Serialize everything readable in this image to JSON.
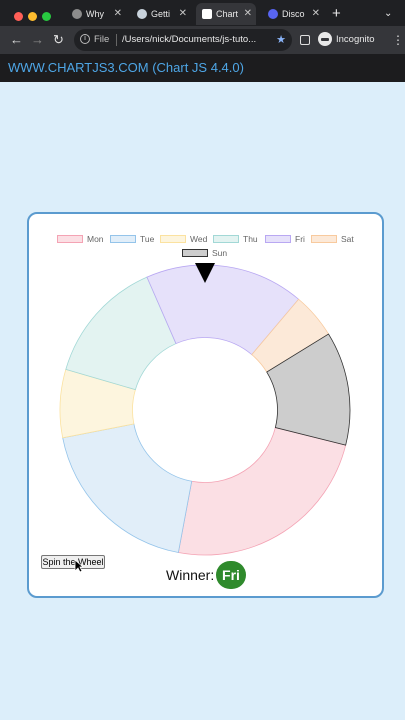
{
  "browser": {
    "tabs": [
      {
        "label": "Why",
        "icon": "github-icon",
        "active": false
      },
      {
        "label": "Getti",
        "icon": "wordpress-icon",
        "active": false
      },
      {
        "label": "Chart",
        "icon": "chart-logo-icon",
        "active": true
      },
      {
        "label": "Disco",
        "icon": "discord-icon",
        "active": false
      }
    ],
    "new_tab_label": "+",
    "file_label": "File",
    "url": "/Users/nick/Documents/js-tuto...",
    "profile_label": "Incognito",
    "window_controls_colors": [
      "#ff5f57",
      "#febc2e",
      "#28c840"
    ]
  },
  "site": {
    "title": "WWW.CHARTJS3.COM (Chart JS 4.4.0)"
  },
  "spin_button_label": "Spin the Wheel",
  "winner": {
    "label": "Winner:",
    "value": "Fri",
    "badge_color": "#2f8a2c"
  },
  "chart_data": {
    "type": "doughnut",
    "labels": [
      "Mon",
      "Tue",
      "Wed",
      "Thu",
      "Fri",
      "Sat",
      "Sun"
    ],
    "values": [
      19,
      15,
      6,
      11,
      14,
      4,
      10
    ],
    "background_colors": [
      "#fbdfe4",
      "#e1eef9",
      "#fdf5de",
      "#e3f3f1",
      "#e6e1fa",
      "#fce9d8",
      "#cdcdcd"
    ],
    "border_colors": [
      "#f4a3b4",
      "#94c4ea",
      "#fbe2a0",
      "#a2d8d6",
      "#b9a8f2",
      "#f8ca9e",
      "#333333"
    ],
    "rotation_deg": 104,
    "cutout": 0.5,
    "legend_position": "top"
  }
}
